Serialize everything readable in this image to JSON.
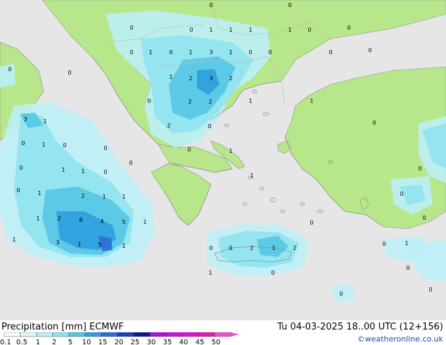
{
  "map": {
    "colors": {
      "sea": "#e6e6e6",
      "land": "#b8e68a",
      "p1": "#bdeff6",
      "p2": "#8fe3ef",
      "p3": "#55c6e4",
      "p4": "#2f9fde",
      "p5": "#2b6fd3",
      "coast": "#8c8c8c",
      "border": "#bdbdbd"
    },
    "values": [
      "0",
      "1",
      "1",
      "1",
      "0",
      "0",
      "0",
      "1",
      "0",
      "1",
      "1",
      "3",
      "1",
      "0",
      "0",
      "0",
      "0",
      "1",
      "0",
      "2",
      "3",
      "2",
      "1",
      "0",
      "2",
      "2",
      "0",
      "3",
      "1",
      "2",
      "0",
      "0",
      "0",
      "0",
      "1",
      "1",
      "1",
      "0",
      "0",
      "1",
      "1",
      "2",
      "1",
      "1",
      "1",
      "2",
      "8",
      "4",
      "5",
      "1",
      "1",
      "1",
      "3",
      "1",
      "5",
      "1",
      "0",
      "2",
      "1",
      "2",
      "1",
      "0",
      "0",
      "1",
      "0",
      "0",
      "0",
      "0",
      "0",
      "0",
      "0",
      "0",
      "1",
      "0",
      "0",
      "0",
      "0",
      "0",
      "0",
      "0"
    ]
  },
  "footer": {
    "title": "Precipitation [mm] ECMWF",
    "run_info": "Tu 04-03-2025 18..00 UTC (12+156)",
    "credit": "©weatheronline.co.uk",
    "scale_labels": [
      "0.1",
      "0.5",
      "1",
      "2",
      "5",
      "10",
      "15",
      "20",
      "25",
      "30",
      "35",
      "40",
      "45",
      "50"
    ],
    "scale_colors": [
      "#fafafa",
      "#e0f8fb",
      "#bdeff6",
      "#8fe3ef",
      "#55c6e4",
      "#2f9fde",
      "#2b6fd3",
      "#1d3fc0",
      "#0a1a8f",
      "#a812e0",
      "#c812e8",
      "#e010d8",
      "#e815b8",
      "#f050c8"
    ]
  }
}
